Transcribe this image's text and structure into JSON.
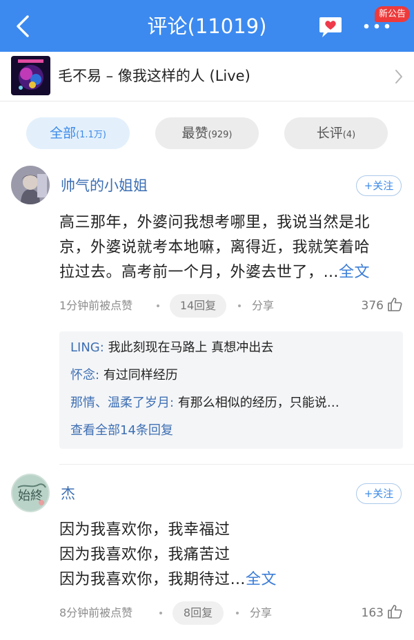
{
  "header": {
    "title": "评论(11019)",
    "badge": "新公告",
    "icons": {
      "back": "back-arrow-icon",
      "chat": "chat-heart-icon",
      "more": "more-dots-icon"
    },
    "colors": {
      "bar": "#3c8af0",
      "badge": "#ee3a3a"
    }
  },
  "song": {
    "title": "毛不易 – 像我这样的人 (Live)",
    "icons": {
      "cover": "album-cover-icon",
      "arrow": "chevron-right-icon"
    }
  },
  "tabs": [
    {
      "label": "全部",
      "count": "(1.1万)"
    },
    {
      "label": "最赞",
      "count": "(929)"
    },
    {
      "label": "长评",
      "count": "(4)"
    }
  ],
  "comments": [
    {
      "user": "帅气的小姐姐",
      "follow": "+关注",
      "lines": [
        "高三那年，外婆问我想考哪里，我说当然是北",
        "京，外婆说就考本地嘛，离得近，我就笑着哈",
        "拉过去。高考前一个月，外婆去世了，…"
      ],
      "more": "全文",
      "time": "1分钟前被点赞",
      "replies": "14回复",
      "share": "分享",
      "likes": "376",
      "reply_list": [
        {
          "name": "LING:",
          "text": "我此刻现在马路上 真想冲出去"
        },
        {
          "name": "怀念:",
          "text": "有过同样经历"
        },
        {
          "name": "那情、温柔了岁月:",
          "text": "有那么相似的经历，只能说…"
        }
      ],
      "view_all": "查看全部14条回复"
    },
    {
      "user": "杰",
      "follow": "+关注",
      "lines": [
        "因为我喜欢你，我幸福过",
        "因为我喜欢你，我痛苦过",
        "因为我喜欢你，我期待过…"
      ],
      "more": "全文",
      "time": "8分钟前被点赞",
      "replies": "8回复",
      "share": "分享",
      "likes": "163"
    }
  ],
  "accent": "#3c8ae8"
}
